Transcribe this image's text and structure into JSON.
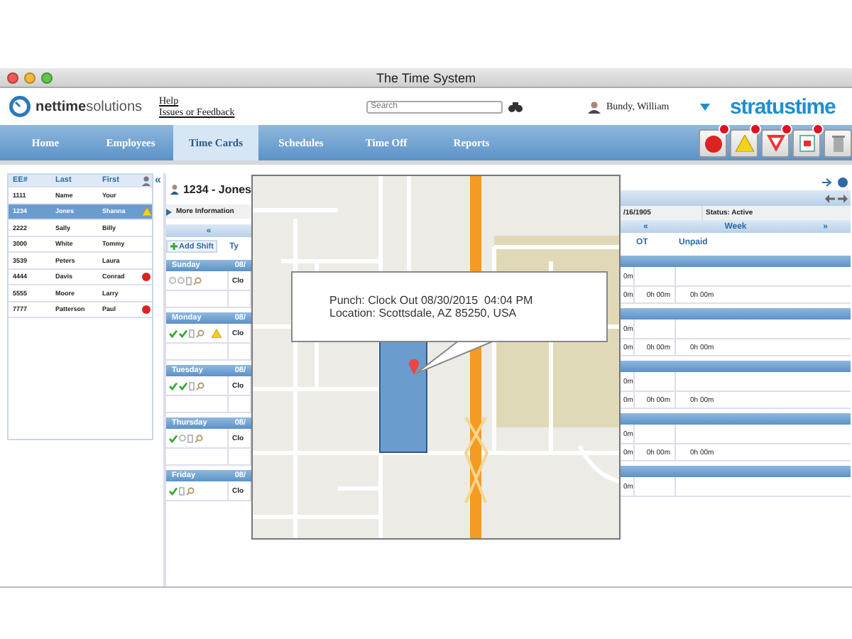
{
  "window": {
    "title": "The Time System"
  },
  "header": {
    "brand": "nettime",
    "brand_suffix": "solutions",
    "links": [
      "Help",
      "Issues or Feedback"
    ],
    "search": {
      "placeholder": "Search"
    },
    "user": "Bundy, William",
    "product": "stratustime"
  },
  "nav": {
    "tabs": [
      {
        "label": "Home",
        "selected": false
      },
      {
        "label": "Employees",
        "selected": false
      },
      {
        "label": "Time Cards",
        "selected": true
      },
      {
        "label": "Schedules",
        "selected": false
      },
      {
        "label": "Time Off",
        "selected": false
      },
      {
        "label": "Reports",
        "selected": false
      }
    ]
  },
  "toolbar": [
    {
      "kind": "stop",
      "badge": true
    },
    {
      "kind": "warning",
      "badge": true
    },
    {
      "kind": "filter",
      "badge": true
    },
    {
      "kind": "calendar",
      "badge": true
    },
    {
      "kind": "trash",
      "badge": false
    }
  ],
  "employee_list": {
    "columns": [
      "EE#",
      "Last",
      "First"
    ],
    "collapse": "«",
    "rows": [
      {
        "id": "1111",
        "last": "Name",
        "first": "Your",
        "selected": false,
        "warning": false,
        "alert": false
      },
      {
        "id": "1234",
        "last": "Jones",
        "first": "Shanna",
        "selected": true,
        "warning": true,
        "alert": false
      },
      {
        "id": "2222",
        "last": "Sally",
        "first": "Billy",
        "selected": false,
        "warning": false,
        "alert": false
      },
      {
        "id": "3000",
        "last": "White",
        "first": "Tommy",
        "selected": false,
        "warning": false,
        "alert": false
      },
      {
        "id": "3539",
        "last": "Peters",
        "first": "Laura",
        "selected": false,
        "warning": false,
        "alert": false
      },
      {
        "id": "4444",
        "last": "Davis",
        "first": "Conrad",
        "selected": false,
        "warning": false,
        "alert": true
      },
      {
        "id": "5555",
        "last": "Moore",
        "first": "Larry",
        "selected": false,
        "warning": false,
        "alert": false
      },
      {
        "id": "7777",
        "last": "Patterson",
        "first": "Paul",
        "selected": false,
        "warning": false,
        "alert": true
      }
    ]
  },
  "timecard": {
    "employee": "1234 - Jones",
    "more_info": "More Information",
    "prev": "«",
    "add_shift": "Add Shift",
    "column_cut": "Ty",
    "period": "/16/1905",
    "status": "Status: Active",
    "week_prev": "«",
    "week": "Week",
    "week_next": "»",
    "columns": [
      "OT",
      "Unpaid"
    ],
    "days": [
      {
        "day": "Sunday",
        "date": "08/",
        "approvals": [
          false,
          false
        ],
        "warning": false,
        "type": "Clo",
        "rows": [
          {
            "cut": "0m"
          },
          {
            "cut": "0m",
            "ot": "0h 00m",
            "unpaid": "0h 00m"
          }
        ]
      },
      {
        "day": "Monday",
        "date": "08/",
        "approvals": [
          true,
          true
        ],
        "warning": true,
        "type": "Clo",
        "rows": [
          {
            "cut": "0m"
          },
          {
            "cut": "0m",
            "ot": "0h 00m",
            "unpaid": "0h 00m"
          }
        ]
      },
      {
        "day": "Tuesday",
        "date": "08/",
        "approvals": [
          true,
          true
        ],
        "warning": false,
        "type": "Clo",
        "rows": [
          {
            "cut": "0m"
          },
          {
            "cut": "0m",
            "ot": "0h 00m",
            "unpaid": "0h 00m"
          }
        ]
      },
      {
        "day": "Thursday",
        "date": "08/",
        "approvals": [
          true,
          false
        ],
        "warning": false,
        "type": "Clo",
        "rows": [
          {
            "cut": "0m"
          },
          {
            "cut": "0m",
            "ot": "0h 00m",
            "unpaid": "0h 00m"
          }
        ]
      },
      {
        "day": "Friday",
        "date": "08/",
        "approvals": [
          true
        ],
        "warning": false,
        "type": "Clo",
        "rows": [
          {
            "cut": "0m"
          }
        ]
      }
    ]
  },
  "map": {
    "popup": [
      "Punch: Clock Out 08/30/2015  04:04 PM",
      "Location: Scottsdale, AZ 85250, USA"
    ]
  }
}
